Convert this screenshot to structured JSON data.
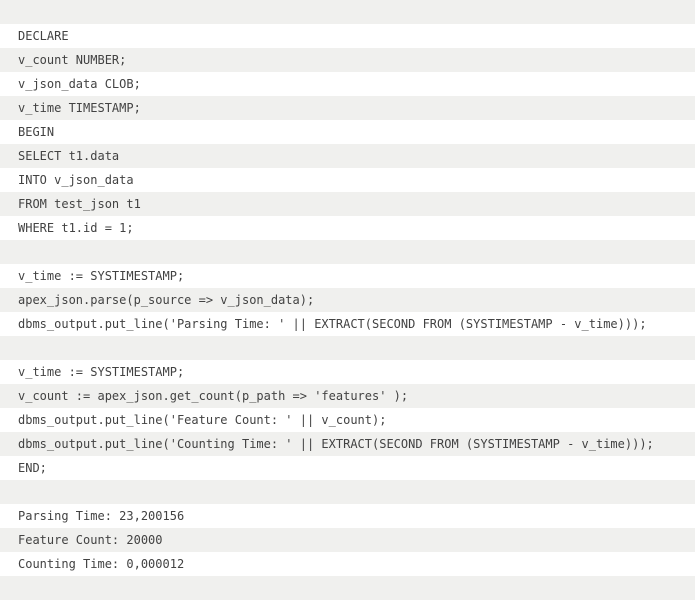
{
  "lines": [
    "",
    "DECLARE",
    "v_count NUMBER;",
    "v_json_data CLOB;",
    "v_time TIMESTAMP;",
    "BEGIN",
    "SELECT t1.data",
    "INTO v_json_data",
    "FROM test_json t1",
    "WHERE t1.id = 1;",
    "",
    "v_time := SYSTIMESTAMP;",
    "apex_json.parse(p_source => v_json_data);",
    "dbms_output.put_line('Parsing Time: ' || EXTRACT(SECOND FROM (SYSTIMESTAMP - v_time)));",
    "",
    "v_time := SYSTIMESTAMP;",
    "v_count := apex_json.get_count(p_path => 'features' );",
    "dbms_output.put_line('Feature Count: ' || v_count);",
    "dbms_output.put_line('Counting Time: ' || EXTRACT(SECOND FROM (SYSTIMESTAMP - v_time)));",
    "END;",
    "",
    "Parsing Time: 23,200156",
    "Feature Count: 20000",
    "Counting Time: 0,000012",
    ""
  ]
}
